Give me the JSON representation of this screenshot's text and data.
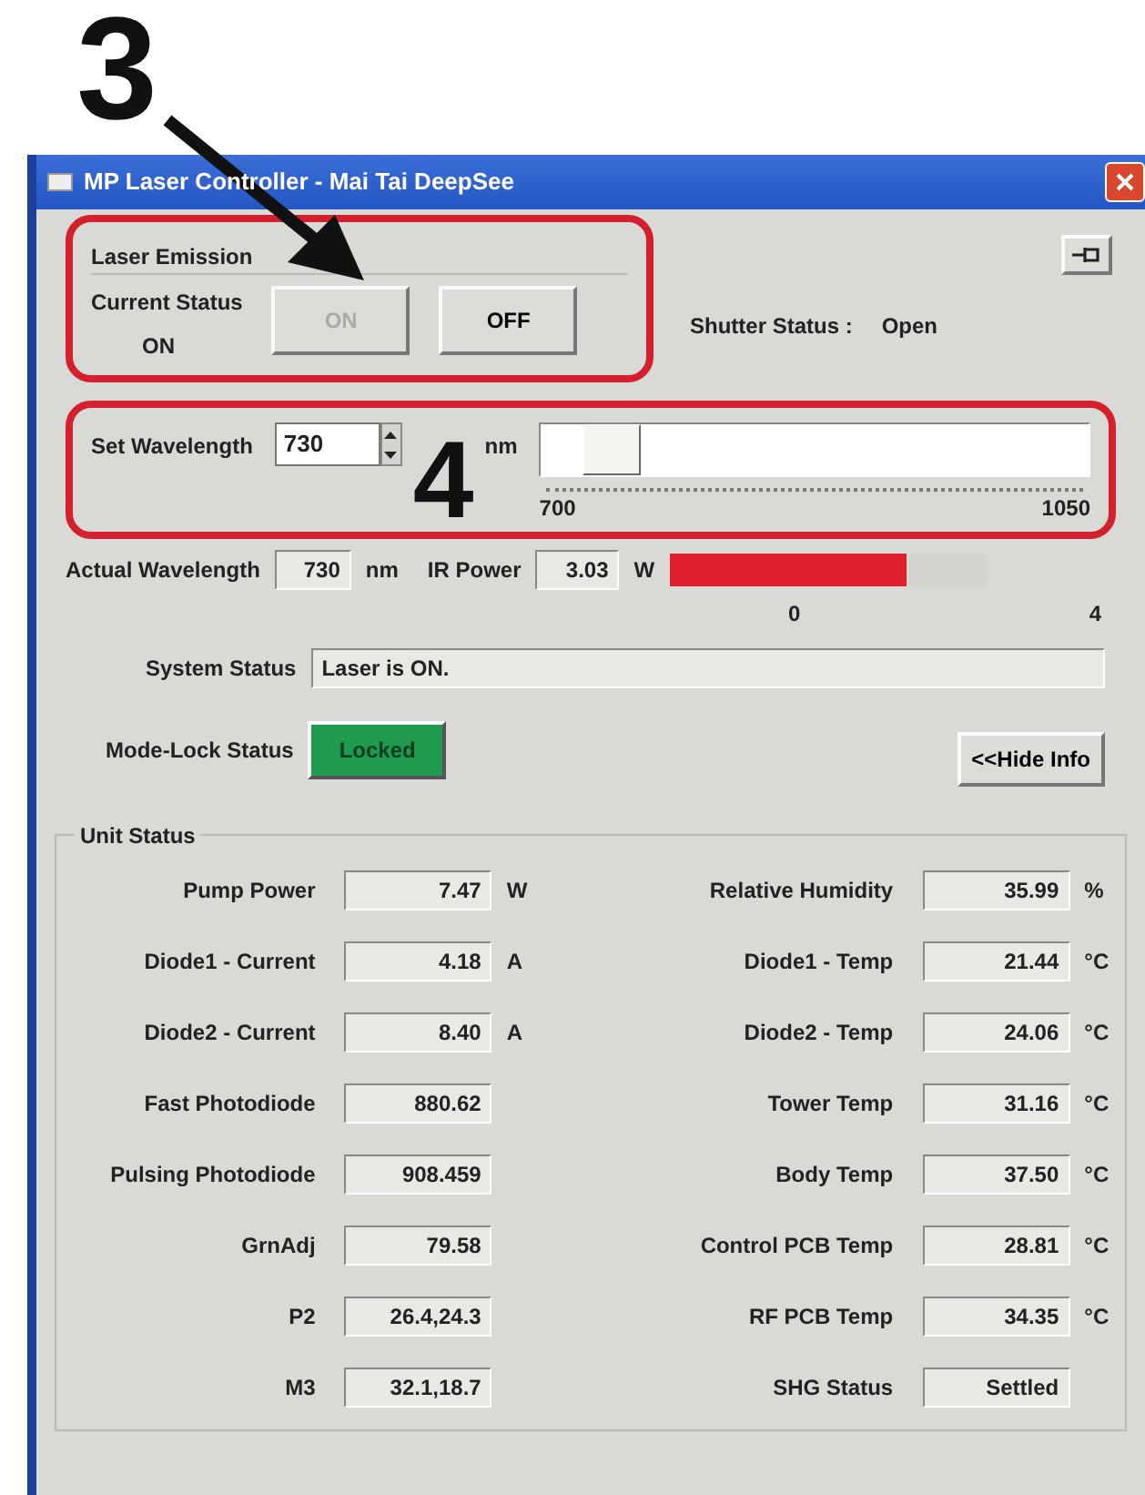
{
  "annotations": [
    {
      "label": "3"
    },
    {
      "label": "4"
    }
  ],
  "window": {
    "title": "MP Laser Controller - Mai Tai DeepSee"
  },
  "laser_emission": {
    "title": "Laser Emission",
    "status_label": "Current Status",
    "status_value": "ON",
    "buttons": [
      {
        "label": "ON",
        "disabled": true
      },
      {
        "label": "OFF",
        "disabled": false
      }
    ]
  },
  "shutter": {
    "label": "Shutter Status :",
    "value": "Open"
  },
  "set_wavelength": {
    "label": "Set Wavelength",
    "value": "730",
    "unit": "nm",
    "slider": {
      "level": 0.086,
      "min_label": "700",
      "max_label": "1050"
    }
  },
  "actual_wavelength": {
    "label": "Actual Wavelength",
    "value": "730",
    "unit": "nm"
  },
  "ir_power": {
    "label": "IR Power",
    "value": "3.03",
    "unit": "W",
    "level": 0.75,
    "min_label": "0",
    "max_label": "4"
  },
  "system_status": {
    "label": "System Status",
    "value": "Laser is ON."
  },
  "mode_lock": {
    "label": "Mode-Lock Status",
    "value": "Locked",
    "locked": true
  },
  "hide_info_button": "<<Hide Info",
  "unit_status": {
    "title": "Unit Status",
    "rows": [
      {
        "left": {
          "label": "Pump Power",
          "value": "7.47",
          "unit": "W"
        },
        "right": {
          "label": "Relative Humidity",
          "value": "35.99",
          "unit": "%"
        }
      },
      {
        "left": {
          "label": "Diode1 - Current",
          "value": "4.18",
          "unit": "A"
        },
        "right": {
          "label": "Diode1 - Temp",
          "value": "21.44",
          "unit": "°C"
        }
      },
      {
        "left": {
          "label": "Diode2 - Current",
          "value": "8.40",
          "unit": "A"
        },
        "right": {
          "label": "Diode2 - Temp",
          "value": "24.06",
          "unit": "°C"
        }
      },
      {
        "left": {
          "label": "Fast Photodiode",
          "value": "880.62"
        },
        "right": {
          "label": "Tower Temp",
          "value": "31.16",
          "unit": "°C"
        }
      },
      {
        "left": {
          "label": "Pulsing Photodiode",
          "value": "908.459"
        },
        "right": {
          "label": "Body Temp",
          "value": "37.50",
          "unit": "°C"
        }
      },
      {
        "left": {
          "label": "GrnAdj",
          "value": "79.58"
        },
        "right": {
          "label": "Control PCB Temp",
          "value": "28.81",
          "unit": "°C"
        }
      },
      {
        "left": {
          "label": "P2",
          "value": "26.4,24.3"
        },
        "right": {
          "label": "RF PCB Temp",
          "value": "34.35",
          "unit": "°C"
        }
      },
      {
        "left": {
          "label": "M3",
          "value": "32.1,18.7"
        },
        "right": {
          "label": "SHG Status",
          "value": "Settled"
        }
      }
    ]
  }
}
